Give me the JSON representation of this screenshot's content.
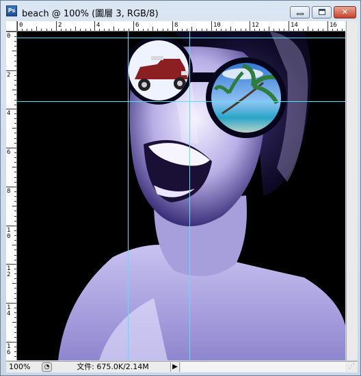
{
  "window": {
    "app_icon_label": "Ps",
    "title": "beach @ 100% (圖層 3, RGB/8)"
  },
  "ruler": {
    "top_labels": [
      "0",
      "2",
      "4",
      "6",
      "8",
      "10",
      "12",
      "14",
      "16"
    ],
    "left_labels": [
      "0",
      "2",
      "4",
      "6",
      "8",
      "1\n0",
      "1\n2",
      "1\n4",
      "1\n6"
    ]
  },
  "statusbar": {
    "zoom": "100%",
    "doc_size": "文件: 675.0K/2.14M",
    "arrow": "▶"
  },
  "colors": {
    "guide": "#4fe3ff",
    "canvas_bg": "#000000",
    "photo_tint": "#8a7fd6"
  },
  "icons": [
    "photoshop-app-icon",
    "minimize-icon",
    "maximize-icon",
    "close-icon",
    "status-info-icon",
    "resize-grip-icon"
  ]
}
